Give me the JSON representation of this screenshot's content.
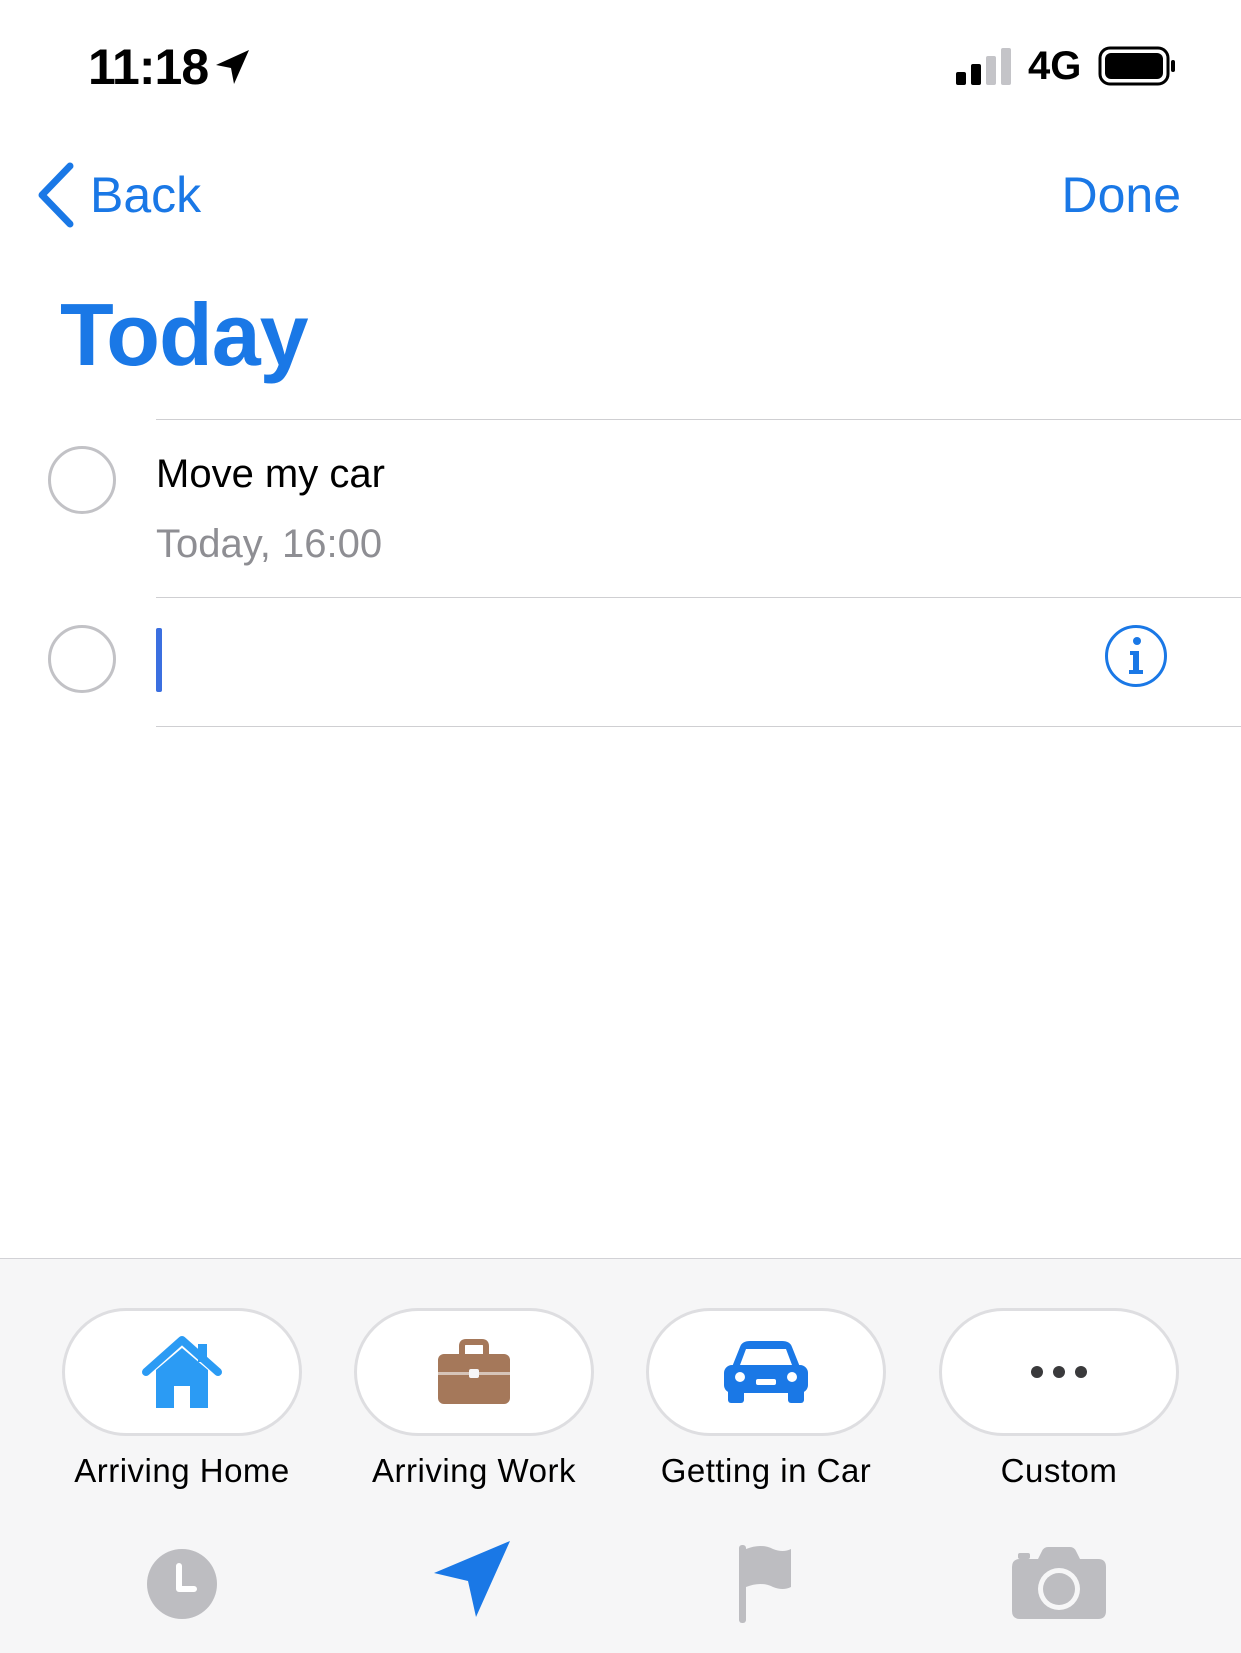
{
  "status_bar": {
    "time": "11:18",
    "network": "4G",
    "icons": [
      "location-arrow-icon",
      "signal-bars-icon",
      "battery-icon"
    ]
  },
  "nav": {
    "back_label": "Back",
    "done_label": "Done"
  },
  "list": {
    "title": "Today",
    "items": [
      {
        "title": "Move my car",
        "subtitle": "Today, 16:00"
      }
    ],
    "new_item": {
      "value": ""
    }
  },
  "toolbar": {
    "suggestions": [
      {
        "label": "Arriving Home",
        "icon": "home-icon",
        "color": "#2b9bf4"
      },
      {
        "label": "Arriving Work",
        "icon": "briefcase-icon",
        "color": "#a5785a"
      },
      {
        "label": "Getting in Car",
        "icon": "car-icon",
        "color": "#1a78e6"
      },
      {
        "label": "Custom",
        "icon": "more-icon",
        "color": "#3a3a3c"
      }
    ],
    "tools": [
      "clock-icon",
      "location-icon",
      "flag-icon",
      "camera-icon"
    ]
  },
  "colors": {
    "accent": "#1a78e6",
    "secondary_text": "#8e8e93",
    "toolbar_bg": "#f6f6f7",
    "inactive_icon": "#bdbdc1"
  }
}
